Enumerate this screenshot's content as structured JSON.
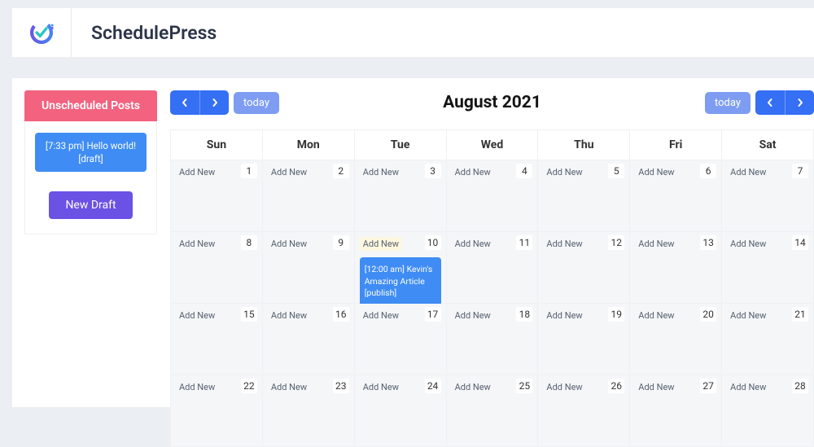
{
  "app": {
    "title": "SchedulePress"
  },
  "sidebar": {
    "header": "Unscheduled Posts",
    "posts": [
      {
        "time": "[7:33 pm]",
        "title": "Hello world!",
        "status": "[draft]"
      }
    ],
    "new_draft": "New Draft"
  },
  "calendar": {
    "today_label": "today",
    "month_title": "August 2021",
    "dow": [
      "Sun",
      "Mon",
      "Tue",
      "Wed",
      "Thu",
      "Fri",
      "Sat"
    ],
    "add_new": "Add New",
    "weeks": [
      [
        {
          "d": 1,
          "add": 1
        },
        {
          "d": 2,
          "add": 1
        },
        {
          "d": 3,
          "add": 1
        },
        {
          "d": 4,
          "add": 1
        },
        {
          "d": 5,
          "add": 1
        },
        {
          "d": 6,
          "add": 1
        },
        {
          "d": 7,
          "add": 1
        }
      ],
      [
        {
          "d": 8,
          "add": 1
        },
        {
          "d": 9,
          "add": 1
        },
        {
          "d": 10,
          "add": 1,
          "hl": 1,
          "post": {
            "time": "[12:00 am]",
            "title": "Kevin's Amazing Article",
            "status": "[publish]"
          }
        },
        {
          "d": 11,
          "add": 1
        },
        {
          "d": 12,
          "add": 1
        },
        {
          "d": 13,
          "add": 1
        },
        {
          "d": 14,
          "add": 1
        }
      ],
      [
        {
          "d": 15,
          "add": 1
        },
        {
          "d": 16,
          "add": 1
        },
        {
          "d": 17,
          "add": 1
        },
        {
          "d": 18,
          "add": 1
        },
        {
          "d": 19,
          "add": 1
        },
        {
          "d": 20,
          "add": 1
        },
        {
          "d": 21,
          "add": 1
        }
      ],
      [
        {
          "d": 22,
          "add": 1
        },
        {
          "d": 23,
          "add": 1
        },
        {
          "d": 24,
          "add": 1
        },
        {
          "d": 25,
          "add": 1
        },
        {
          "d": 26,
          "add": 1
        },
        {
          "d": 27,
          "add": 1
        },
        {
          "d": 28,
          "add": 1
        }
      ]
    ]
  }
}
